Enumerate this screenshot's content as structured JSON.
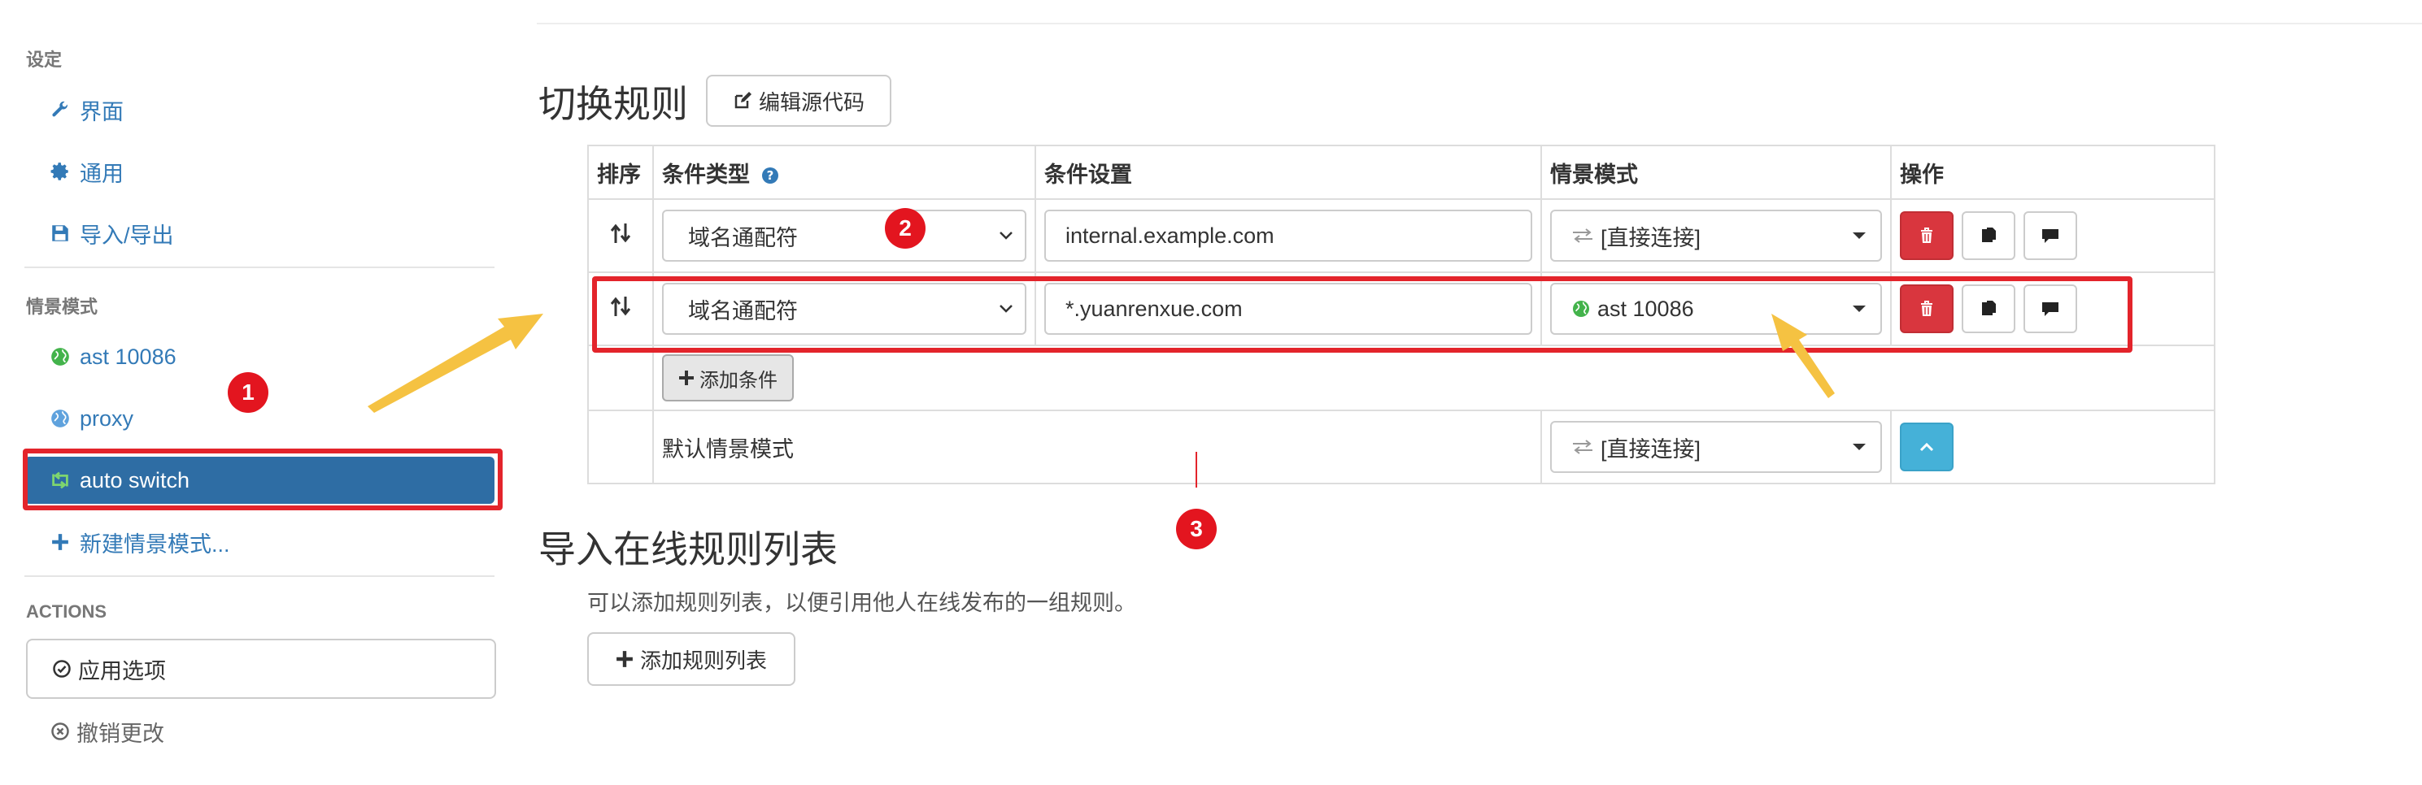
{
  "sidebar": {
    "settings_header": "设定",
    "settings_items": [
      {
        "label": "界面",
        "icon": "wrench-icon"
      },
      {
        "label": "通用",
        "icon": "gear-icon"
      },
      {
        "label": "导入/导出",
        "icon": "floppy-icon"
      }
    ],
    "profiles_header": "情景模式",
    "profiles": [
      {
        "label": "ast 10086",
        "icon": "globe-icon",
        "color": "#43b34b"
      },
      {
        "label": "proxy",
        "icon": "globe-icon",
        "color": "#5fa2dd"
      },
      {
        "label": "auto switch",
        "icon": "switch-icon",
        "color": "#7ed56f",
        "active": true
      }
    ],
    "new_profile": "新建情景模式...",
    "actions_header": "ACTIONS",
    "apply_label": "应用选项",
    "revert_label": "撤销更改"
  },
  "main": {
    "switch_rules_title": "切换规则",
    "edit_source_label": "编辑源代码",
    "table": {
      "headers": {
        "sort": "排序",
        "condition_type": "条件类型",
        "condition_settings": "条件设置",
        "profile": "情景模式",
        "actions": "操作"
      },
      "rows": [
        {
          "condition_type": "域名通配符",
          "condition": "internal.example.com",
          "profile": "[直接连接]",
          "profile_icon": "direct-icon"
        },
        {
          "condition_type": "域名通配符",
          "condition": "*.yuanrenxue.com",
          "profile": "ast 10086",
          "profile_icon": "globe-icon"
        }
      ],
      "add_condition_label": "添加条件",
      "default_label": "默认情景模式",
      "default_profile": "[直接连接]"
    },
    "import_title": "导入在线规则列表",
    "import_desc": "可以添加规则列表，以便引用他人在线发布的一组规则。",
    "add_rule_list_label": "添加规则列表"
  },
  "annotations": {
    "badge1": "1",
    "badge2": "2",
    "badge3": "3",
    "red": "#e3242b",
    "yellow": "#f5c242"
  },
  "colors": {
    "link": "#337ab7",
    "active_bg": "#2e6da4",
    "danger": "#d9363e",
    "info": "#45b1d8"
  }
}
